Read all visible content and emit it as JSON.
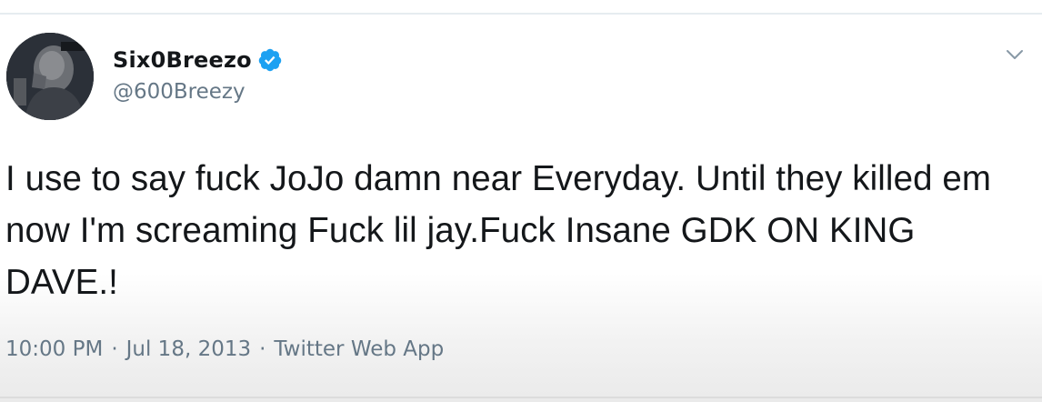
{
  "tweet": {
    "author": {
      "display_name": "Six0Breezo",
      "handle": "@600Breezy",
      "verified": true,
      "avatar_icon": "profile-photo"
    },
    "text": "I use to say fuck JoJo damn near Everyday. Until they killed em now I'm screaming Fuck lil jay.Fuck Insane GDK ON KING DAVE.!",
    "time": "10:00 PM",
    "date": "Jul 18, 2013",
    "source": "Twitter Web App",
    "separator": "·",
    "menu_icon": "chevron-down-icon"
  },
  "colors": {
    "verified_blue": "#1da1f2",
    "secondary_text": "#657786",
    "primary_text": "#14171a"
  }
}
